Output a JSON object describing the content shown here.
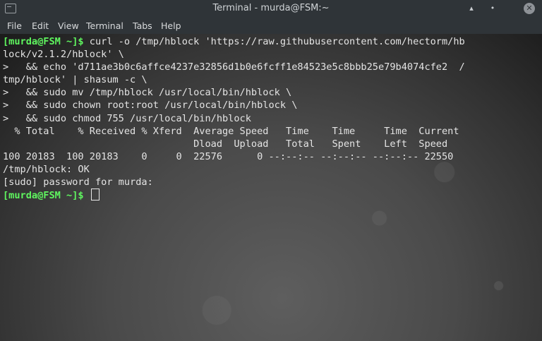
{
  "window": {
    "title": "Terminal - murda@FSM:~"
  },
  "menu": [
    "File",
    "Edit",
    "View",
    "Terminal",
    "Tabs",
    "Help"
  ],
  "prompt": "[murda@FSM ~]$",
  "lines": [
    " curl -o /tmp/hblock 'https://raw.githubusercontent.com/hectorm/hb",
    "lock/v2.1.2/hblock' \\",
    ">   && echo 'd711ae3b0c6affce4237e32856d1b0e6fcff1e84523e5c8bbb25e79b4074cfe2  /",
    "tmp/hblock' | shasum -c \\",
    ">   && sudo mv /tmp/hblock /usr/local/bin/hblock \\",
    ">   && sudo chown root:root /usr/local/bin/hblock \\",
    ">   && sudo chmod 755 /usr/local/bin/hblock",
    "  % Total    % Received % Xferd  Average Speed   Time    Time     Time  Current",
    "                                 Dload  Upload   Total   Spent    Left  Speed",
    "100 20183  100 20183    0     0  22576      0 --:--:-- --:--:-- --:--:-- 22550",
    "/tmp/hblock: OK",
    "[sudo] password for murda:"
  ]
}
